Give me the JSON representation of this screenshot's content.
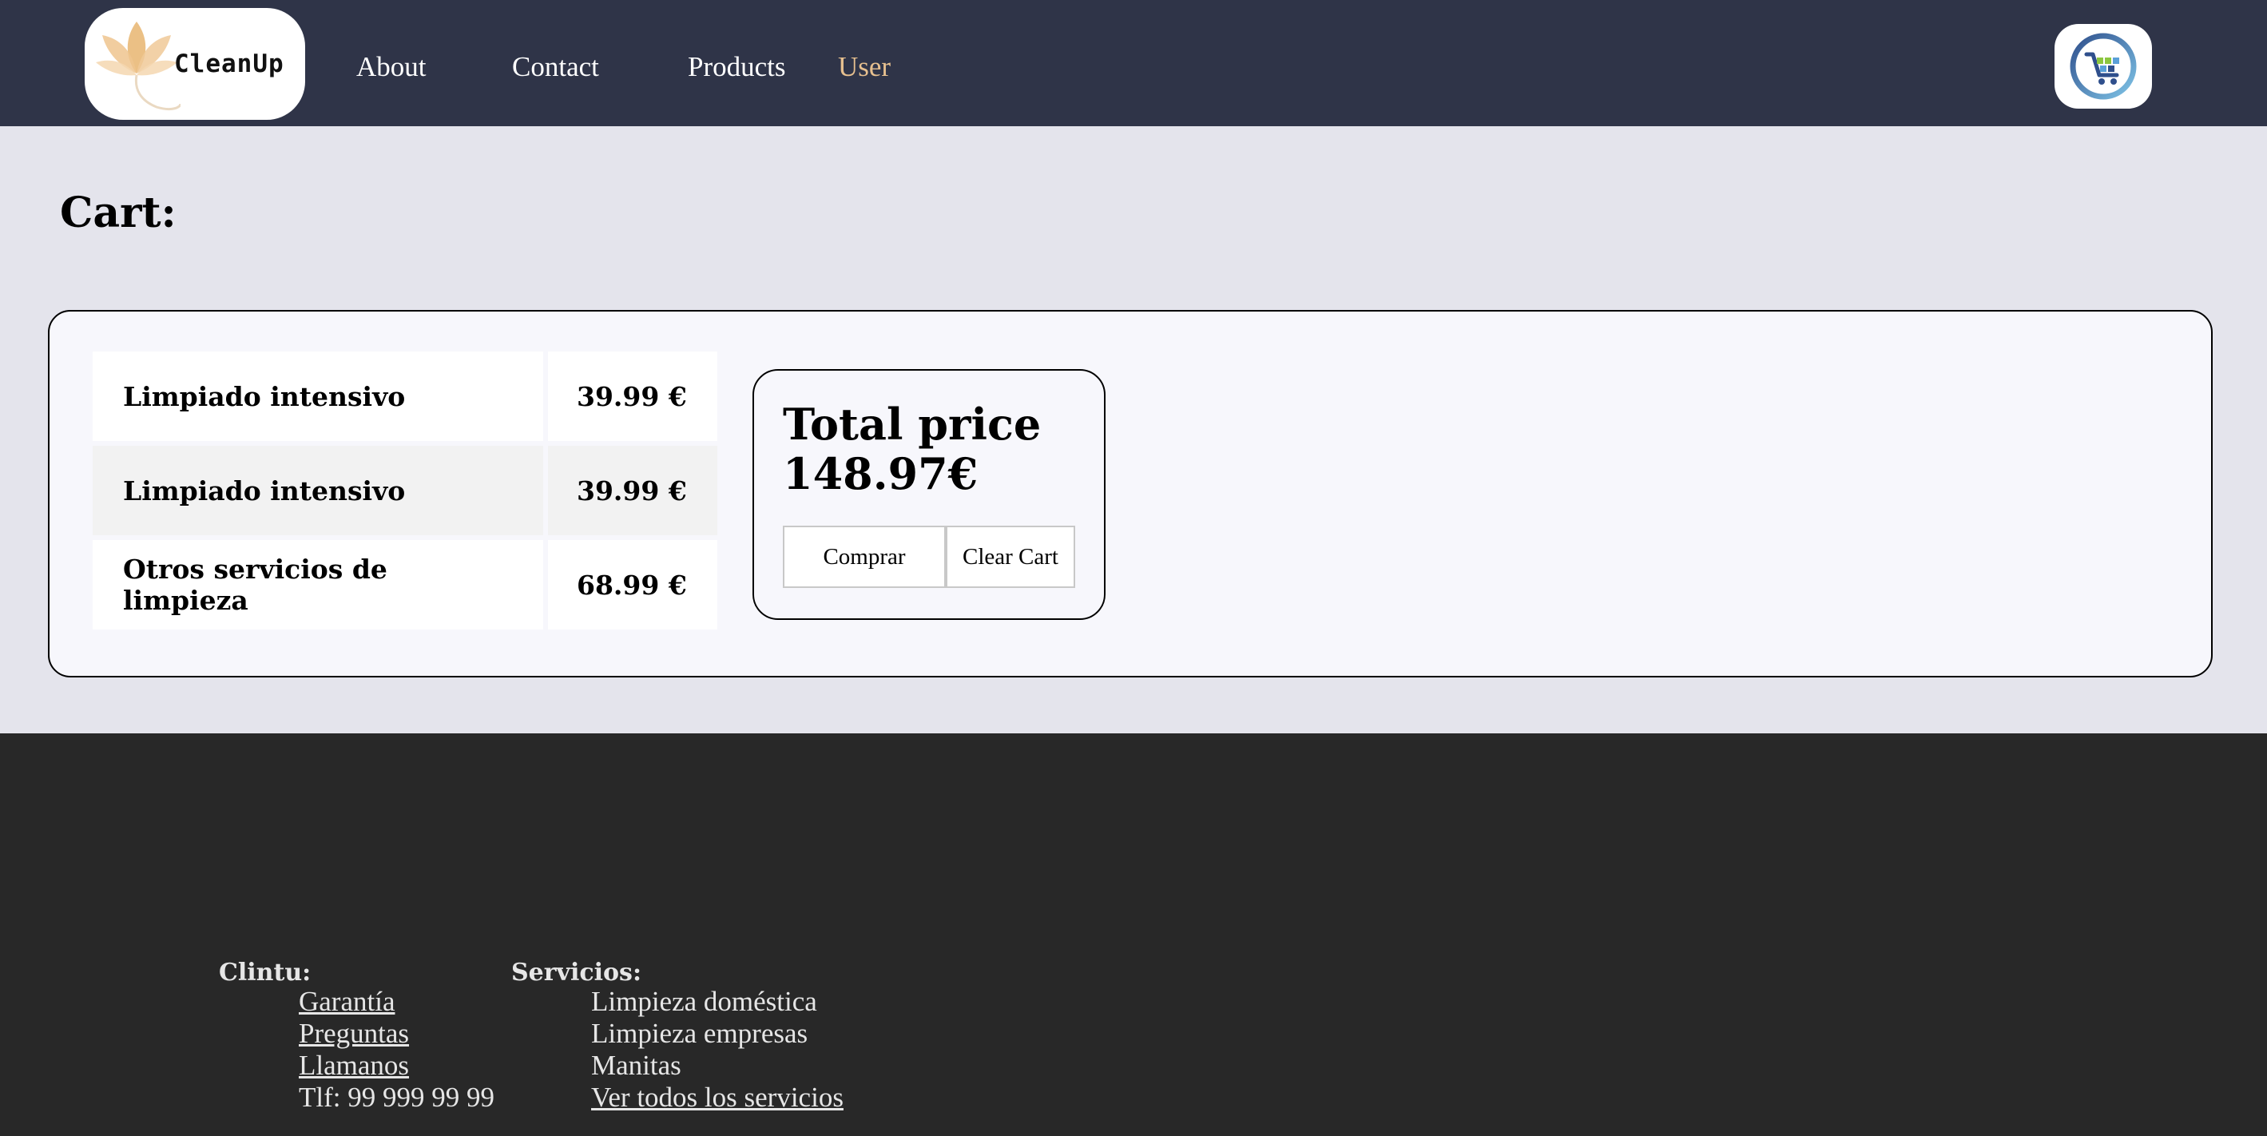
{
  "header": {
    "logo_text": "CleanUp",
    "nav": [
      "About",
      "Contact",
      "Products",
      "User"
    ],
    "active_nav_color": "#e7c08f"
  },
  "main": {
    "title": "Cart:",
    "items": [
      {
        "name": "Limpiado intensivo",
        "price": "39.99 €"
      },
      {
        "name": "Limpiado intensivo",
        "price": "39.99 €"
      },
      {
        "name": "Otros servicios de limpieza",
        "price": "68.99 €"
      }
    ],
    "total_label": "Total price",
    "total_value": "148.97€",
    "buy_label": "Comprar",
    "clear_label": "Clear Cart"
  },
  "footer": {
    "col1": {
      "heading": "Clintu:",
      "links": [
        "Garantía",
        "Preguntas",
        "Llamanos"
      ],
      "phone": "Tlf: 99 999 99 99"
    },
    "col2": {
      "heading": "Servicios:",
      "items": [
        "Limpieza doméstica",
        "Limpieza empresas",
        "Manitas"
      ],
      "link": "Ver todos los servicios"
    }
  },
  "icons": {
    "logo": "lotus-flower-icon",
    "cart": "shopping-cart-icon"
  }
}
